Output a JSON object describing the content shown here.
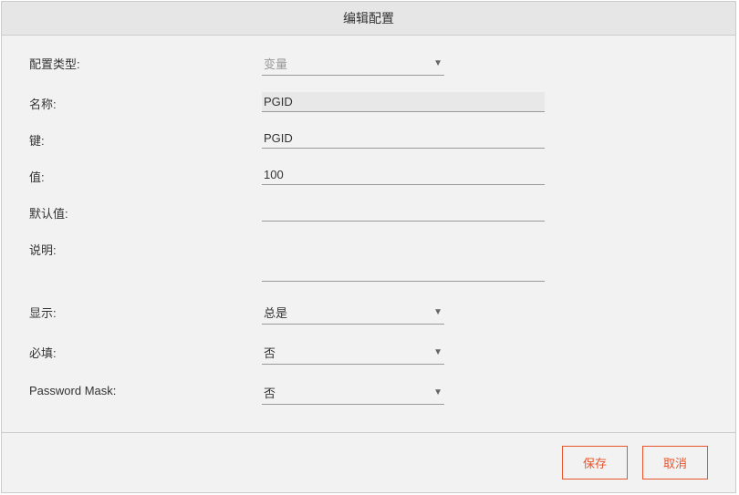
{
  "dialog": {
    "title": "编辑配置"
  },
  "form": {
    "configType": {
      "label": "配置类型:",
      "value": "变量"
    },
    "name": {
      "label": "名称:",
      "value": "PGID"
    },
    "key": {
      "label": "键:",
      "value": "PGID"
    },
    "value": {
      "label": "值:",
      "value": "100"
    },
    "default": {
      "label": "默认值:",
      "value": ""
    },
    "desc": {
      "label": "说明:",
      "value": ""
    },
    "display": {
      "label": "显示:",
      "value": "总是"
    },
    "required": {
      "label": "必填:",
      "value": "否"
    },
    "pwmask": {
      "label": "Password Mask:",
      "value": "否"
    }
  },
  "buttons": {
    "save": "保存",
    "cancel": "取消"
  }
}
